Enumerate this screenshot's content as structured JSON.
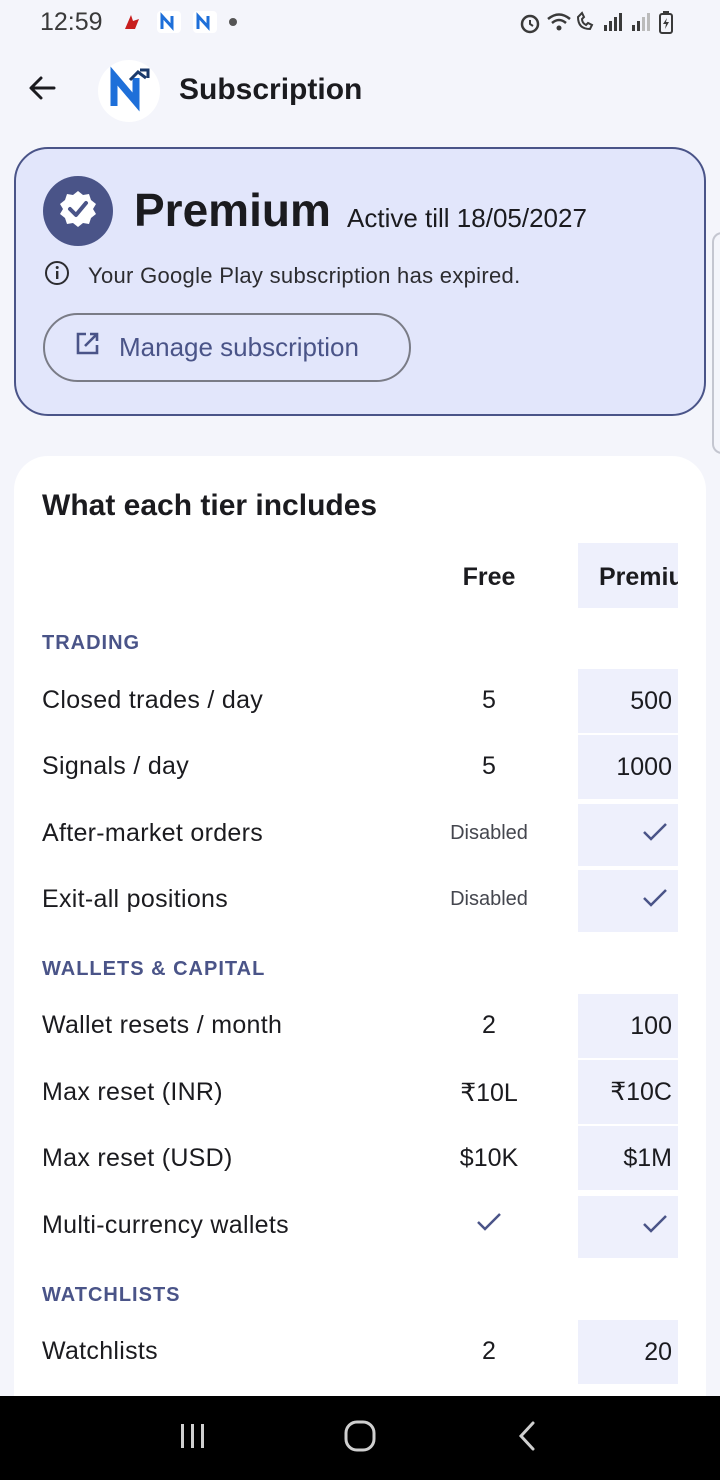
{
  "status_bar": {
    "time": "12:59",
    "left_icons": [
      "airline-icon",
      "app-n-icon",
      "app-n-icon",
      "dot"
    ],
    "right_icons": [
      "alarm-icon",
      "wifi-icon",
      "wifi-call-icon",
      "signal-icon",
      "signal-r-icon",
      "battery-charging-icon"
    ]
  },
  "app_bar": {
    "title": "Subscription",
    "back_icon": "arrow-left-icon",
    "logo_icon": "n-chart-logo"
  },
  "premium_card": {
    "plan_name": "Premium",
    "active_till": "Active till 18/05/2027",
    "info_text": "Your Google Play subscription has expired.",
    "manage_button_label": "Manage subscription",
    "badge_icon": "verified-check-icon",
    "info_icon": "info-icon",
    "manage_icon": "open-external-icon"
  },
  "tiers": {
    "title": "What each tier includes",
    "columns": [
      "Free",
      "Premium"
    ],
    "sections": [
      {
        "name": "TRADING",
        "rows": [
          {
            "label": "Closed trades / day",
            "free": "5",
            "premium": "500"
          },
          {
            "label": "Signals / day",
            "free": "5",
            "premium": "1000"
          },
          {
            "label": "After-market orders",
            "free": "Disabled",
            "premium": "✓"
          },
          {
            "label": "Exit-all positions",
            "free": "Disabled",
            "premium": "✓"
          }
        ]
      },
      {
        "name": "WALLETS & CAPITAL",
        "rows": [
          {
            "label": "Wallet resets / month",
            "free": "2",
            "premium": "100"
          },
          {
            "label": "Max reset (INR)",
            "free": "₹10L",
            "premium": "₹10C"
          },
          {
            "label": "Max reset (USD)",
            "free": "$10K",
            "premium": "$1M"
          },
          {
            "label": "Multi-currency wallets",
            "free": "✓",
            "premium": "✓"
          }
        ]
      },
      {
        "name": "WATCHLISTS",
        "rows": [
          {
            "label": "Watchlists",
            "free": "2",
            "premium": "20"
          }
        ]
      }
    ]
  },
  "colors": {
    "accent": "#4a5488",
    "card_bg": "#e2e6fb",
    "premium_col_bg": "#eef0fc",
    "page_bg": "#f4f5fb"
  },
  "nav_bar": {
    "items": [
      "recent-apps-icon",
      "home-icon",
      "back-icon"
    ]
  }
}
